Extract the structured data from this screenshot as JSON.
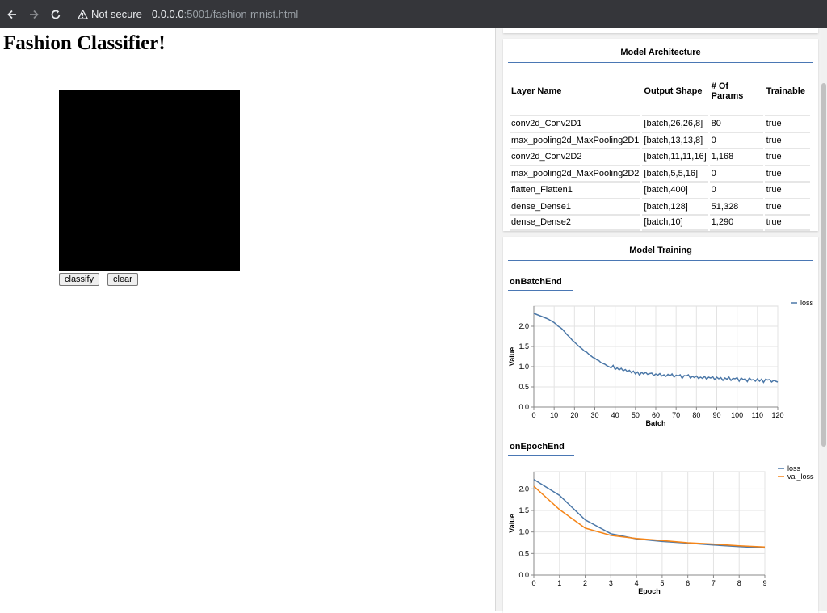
{
  "browser": {
    "security_label": "Not secure",
    "url_host": "0.0.0.0",
    "url_rest": ":5001/fashion-mnist.html"
  },
  "page": {
    "title": "Fashion Classifier!",
    "classify_label": "classify",
    "clear_label": "clear"
  },
  "architecture": {
    "title": "Model Architecture",
    "columns": [
      "Layer Name",
      "Output Shape",
      "# Of Params",
      "Trainable"
    ],
    "rows": [
      [
        "conv2d_Conv2D1",
        "[batch,26,26,8]",
        "80",
        "true"
      ],
      [
        "max_pooling2d_MaxPooling2D1",
        "[batch,13,13,8]",
        "0",
        "true"
      ],
      [
        "conv2d_Conv2D2",
        "[batch,11,11,16]",
        "1,168",
        "true"
      ],
      [
        "max_pooling2d_MaxPooling2D2",
        "[batch,5,5,16]",
        "0",
        "true"
      ],
      [
        "flatten_Flatten1",
        "[batch,400]",
        "0",
        "true"
      ],
      [
        "dense_Dense1",
        "[batch,128]",
        "51,328",
        "true"
      ],
      [
        "dense_Dense2",
        "[batch,10]",
        "1,290",
        "true"
      ]
    ]
  },
  "training": {
    "title": "Model Training",
    "batch_heading": "onBatchEnd",
    "epoch_heading": "onEpochEnd"
  },
  "colors": {
    "loss": "#4c78a8",
    "val_loss": "#f58518",
    "accent": "#4a77b4"
  },
  "chart_data": [
    {
      "type": "line",
      "xlabel": "Batch",
      "ylabel": "Value",
      "xlim": [
        0,
        120
      ],
      "ylim": [
        0,
        2.5
      ],
      "xticks": [
        0,
        10,
        20,
        30,
        40,
        50,
        60,
        70,
        80,
        90,
        100,
        110,
        120
      ],
      "yticks": [
        0,
        0.5,
        1.0,
        1.5,
        2.0
      ],
      "ytick_labels": [
        "0.0",
        "0.5",
        "1.0",
        "1.5",
        "2.0"
      ],
      "grid": true,
      "legend": "top-right",
      "x": [
        0,
        1,
        2,
        3,
        4,
        5,
        6,
        7,
        8,
        9,
        10,
        11,
        12,
        13,
        14,
        15,
        16,
        17,
        18,
        19,
        20,
        21,
        22,
        23,
        24,
        25,
        26,
        27,
        28,
        29,
        30,
        31,
        32,
        33,
        34,
        35,
        36,
        37,
        38,
        39,
        40,
        41,
        42,
        43,
        44,
        45,
        46,
        47,
        48,
        49,
        50,
        51,
        52,
        53,
        54,
        55,
        56,
        57,
        58,
        59,
        60,
        61,
        62,
        63,
        64,
        65,
        66,
        67,
        68,
        69,
        70,
        71,
        72,
        73,
        74,
        75,
        76,
        77,
        78,
        79,
        80,
        81,
        82,
        83,
        84,
        85,
        86,
        87,
        88,
        89,
        90,
        91,
        92,
        93,
        94,
        95,
        96,
        97,
        98,
        99,
        100,
        101,
        102,
        103,
        104,
        105,
        106,
        107,
        108,
        109,
        110,
        111,
        112,
        113,
        114,
        115,
        116,
        117,
        118,
        119,
        120
      ],
      "series": [
        {
          "name": "loss",
          "values": [
            2.32,
            2.3,
            2.28,
            2.26,
            2.24,
            2.22,
            2.2,
            2.18,
            2.15,
            2.12,
            2.09,
            2.05,
            2.0,
            1.97,
            1.93,
            1.87,
            1.81,
            1.76,
            1.71,
            1.65,
            1.61,
            1.56,
            1.51,
            1.47,
            1.43,
            1.38,
            1.36,
            1.31,
            1.27,
            1.23,
            1.21,
            1.17,
            1.15,
            1.1,
            1.08,
            1.06,
            1.02,
            1.0,
            0.97,
            1.03,
            0.93,
            0.97,
            0.92,
            0.96,
            0.9,
            0.93,
            0.88,
            0.91,
            0.85,
            0.89,
            0.82,
            0.87,
            0.79,
            0.86,
            0.82,
            0.86,
            0.81,
            0.83,
            0.84,
            0.78,
            0.82,
            0.79,
            0.83,
            0.77,
            0.8,
            0.76,
            0.81,
            0.77,
            0.82,
            0.74,
            0.79,
            0.77,
            0.8,
            0.71,
            0.78,
            0.77,
            0.8,
            0.72,
            0.76,
            0.73,
            0.77,
            0.71,
            0.74,
            0.71,
            0.76,
            0.69,
            0.74,
            0.72,
            0.75,
            0.68,
            0.74,
            0.7,
            0.73,
            0.66,
            0.72,
            0.69,
            0.74,
            0.66,
            0.71,
            0.7,
            0.73,
            0.64,
            0.72,
            0.68,
            0.7,
            0.63,
            0.72,
            0.67,
            0.68,
            0.64,
            0.7,
            0.64,
            0.69,
            0.61,
            0.69,
            0.67,
            0.68,
            0.62,
            0.66,
            0.64,
            0.62
          ]
        }
      ]
    },
    {
      "type": "line",
      "xlabel": "Epoch",
      "ylabel": "Value",
      "xlim": [
        0,
        9
      ],
      "ylim": [
        0,
        2.4
      ],
      "xticks": [
        0,
        1,
        2,
        3,
        4,
        5,
        6,
        7,
        8,
        9
      ],
      "yticks": [
        0,
        0.5,
        1.0,
        1.5,
        2.0
      ],
      "ytick_labels": [
        "0.0",
        "0.5",
        "1.0",
        "1.5",
        "2.0"
      ],
      "grid": true,
      "legend": "top-right",
      "x": [
        0,
        1,
        2,
        3,
        4,
        5,
        6,
        7,
        8,
        9
      ],
      "series": [
        {
          "name": "loss",
          "values": [
            2.22,
            1.85,
            1.28,
            0.96,
            0.84,
            0.78,
            0.74,
            0.7,
            0.66,
            0.63
          ]
        },
        {
          "name": "val_loss",
          "values": [
            2.06,
            1.52,
            1.09,
            0.92,
            0.85,
            0.8,
            0.75,
            0.72,
            0.68,
            0.65
          ]
        }
      ]
    }
  ]
}
